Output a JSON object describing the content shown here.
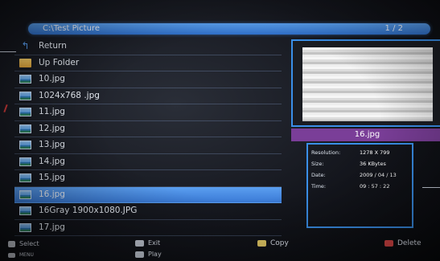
{
  "titlebar": {
    "path": "C:\\Test Picture",
    "page": "1 / 2"
  },
  "files": [
    {
      "label": "Return",
      "icon": "return-arrow-icon",
      "selected": false
    },
    {
      "label": "Up Folder",
      "icon": "folder-icon",
      "selected": false
    },
    {
      "label": "10.jpg",
      "icon": "image-file-icon",
      "selected": false
    },
    {
      "label": "1024x768 .jpg",
      "icon": "image-file-icon",
      "selected": false
    },
    {
      "label": "11.jpg",
      "icon": "image-file-icon",
      "selected": false
    },
    {
      "label": "12.jpg",
      "icon": "image-file-icon",
      "selected": false
    },
    {
      "label": "13.jpg",
      "icon": "image-file-icon",
      "selected": false
    },
    {
      "label": "14.jpg",
      "icon": "image-file-icon",
      "selected": false
    },
    {
      "label": "15.jpg",
      "icon": "image-file-icon",
      "selected": false
    },
    {
      "label": "16.jpg",
      "icon": "image-file-icon",
      "selected": true
    },
    {
      "label": "16Gray 1900x1080.JPG",
      "icon": "image-file-icon",
      "selected": false
    },
    {
      "label": "17.jpg",
      "icon": "image-file-icon",
      "selected": false
    }
  ],
  "preview": {
    "caption": "16.jpg"
  },
  "info": [
    {
      "key": "Resolution:",
      "value": "1278 X 799"
    },
    {
      "key": "Size:",
      "value": "36 KBytes"
    },
    {
      "key": "Date:",
      "value": "2009 / 04 / 13"
    },
    {
      "key": "Time:",
      "value": "09 : 57 : 22"
    }
  ],
  "footer": {
    "select": "Select",
    "menu": "MENU",
    "exit": "Exit",
    "play": "Play",
    "copy": "Copy",
    "delete": "Delete"
  },
  "colors": {
    "accent": "#3a8fe8",
    "selected_row": "#4a8de6",
    "caption_bg": "#7a3e98",
    "copy_key": "#f0d46a",
    "delete_key": "#e04848"
  }
}
